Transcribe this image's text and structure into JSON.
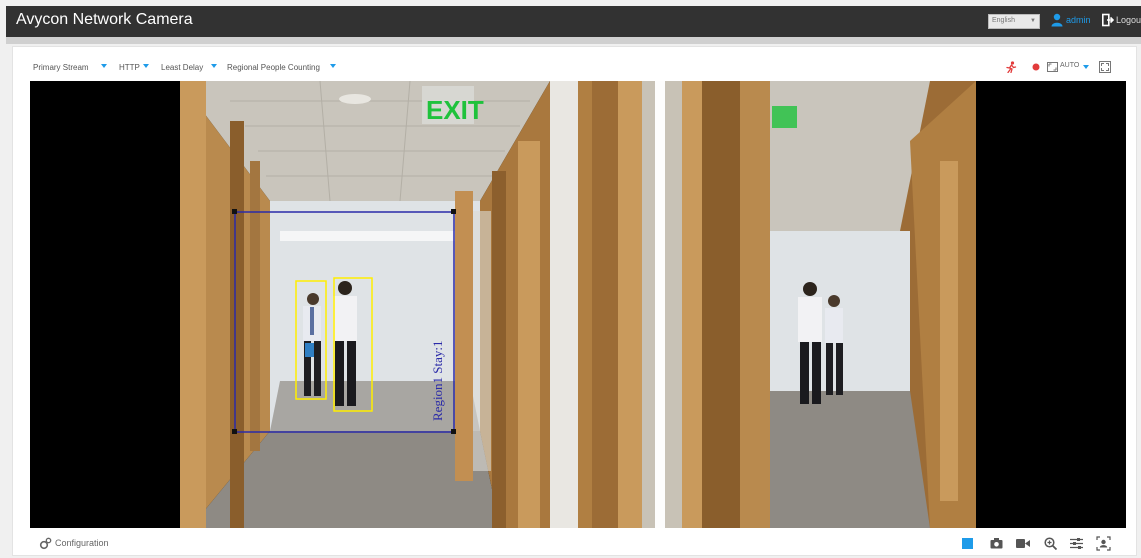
{
  "app": {
    "title": "Avycon Network Camera"
  },
  "header": {
    "language": "English",
    "user": "admin",
    "logout_label": "Logout"
  },
  "toolbar": {
    "stream": "Primary Stream",
    "protocol": "HTTP",
    "delay": "Least Delay",
    "mode": "Regional People Counting",
    "zoom_mode": "AUTO"
  },
  "video": {
    "exit_sign": "EXIT",
    "region_label": "Region1 Stay:1"
  },
  "bottom": {
    "config_label": "Configuration"
  },
  "icons": {
    "user": "user-icon",
    "logout": "logout-icon",
    "alarm": "running-person-icon",
    "record_status": "record-dot-icon",
    "window_mode": "window-icon",
    "fullscreen": "fullscreen-icon",
    "config": "gear-icon",
    "stop": "stop-icon",
    "snapshot": "camera-icon",
    "record": "video-record-icon",
    "zoom": "zoom-icon",
    "settings": "sliders-icon",
    "face": "face-detect-icon"
  },
  "colors": {
    "header_bg": "#323232",
    "accent": "#1e9be9",
    "region_box": "#2a2aa8",
    "detection_box": "#ffee00",
    "alarm": "#e23b3b"
  }
}
